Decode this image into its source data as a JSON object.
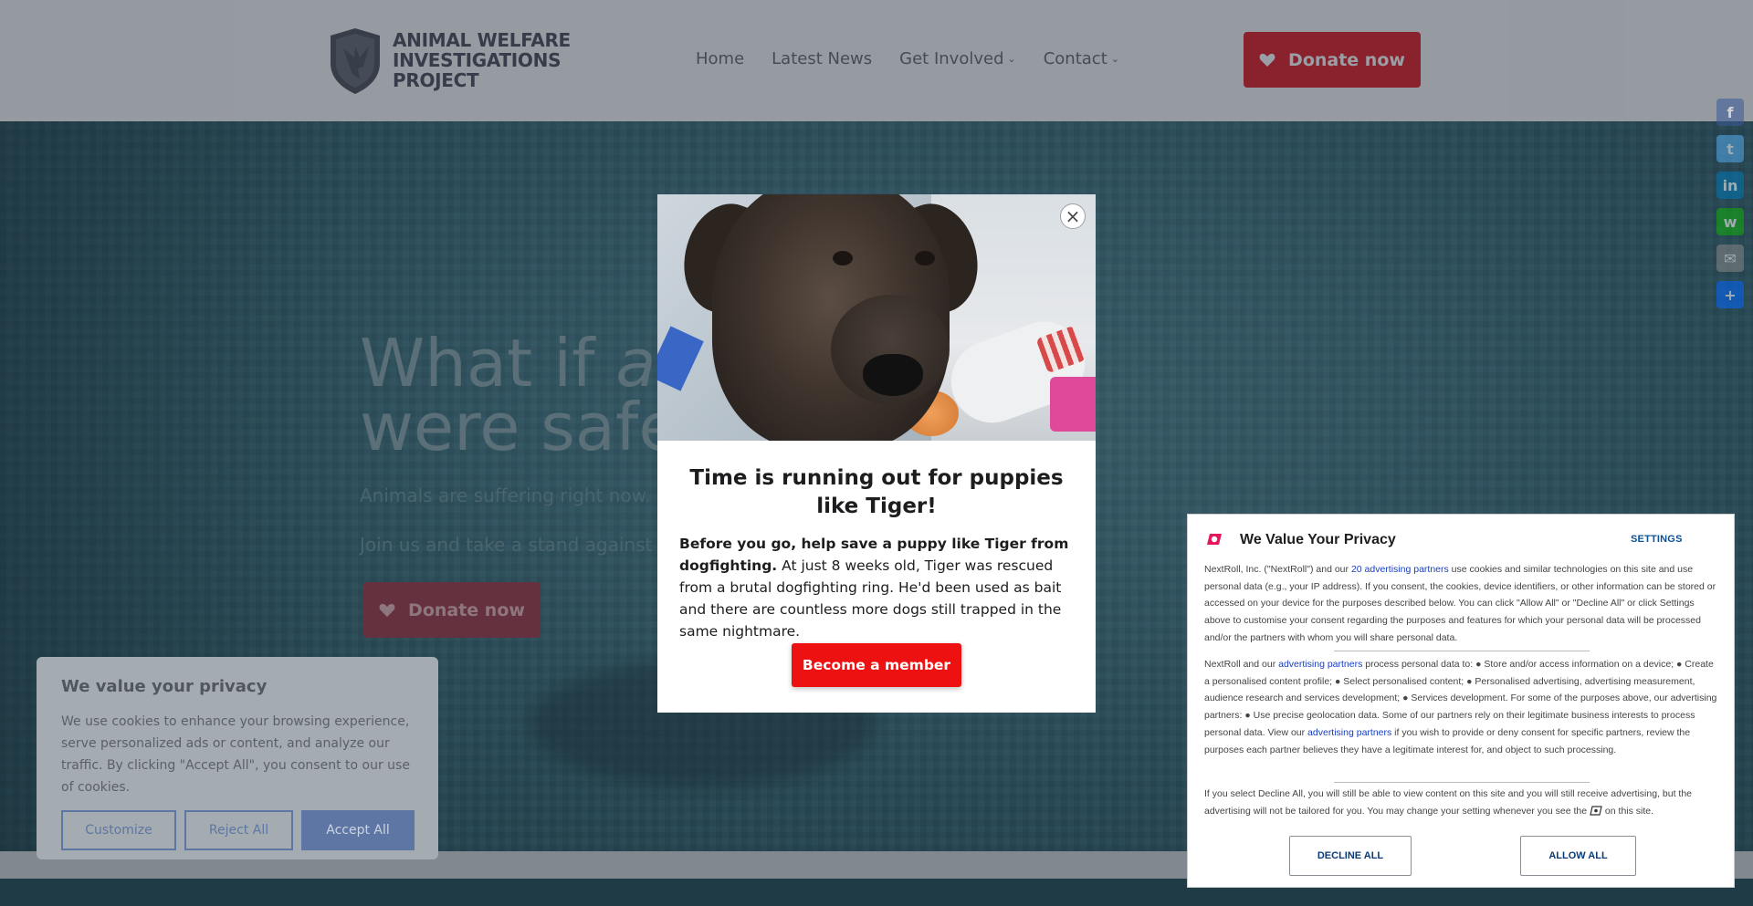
{
  "header": {
    "logo_lines": [
      "ANIMAL WELFARE",
      "INVESTIGATIONS",
      "PROJECT"
    ],
    "nav": [
      {
        "label": "Home",
        "has_dropdown": false
      },
      {
        "label": "Latest News",
        "has_dropdown": false
      },
      {
        "label": "Get Involved",
        "has_dropdown": true
      },
      {
        "label": "Contact",
        "has_dropdown": true
      }
    ],
    "donate_label": "Donate now"
  },
  "hero": {
    "headline_part1": "What if ",
    "headline_italic": "all",
    "headline_line2": "were safe",
    "sub1": "Animals are suffering right now.",
    "sub2": "Join us and take a stand against cr",
    "donate_label": "Donate now"
  },
  "share": {
    "buttons": [
      {
        "name": "facebook-icon",
        "glyph": "f",
        "color": "#3b5998"
      },
      {
        "name": "twitter-icon",
        "glyph": "t",
        "color": "#55acee"
      },
      {
        "name": "linkedin-icon",
        "glyph": "in",
        "color": "#0077b5"
      },
      {
        "name": "whatsapp-icon",
        "glyph": "w",
        "color": "#12af0a"
      },
      {
        "name": "email-icon",
        "glyph": "✉",
        "color": "#888888"
      },
      {
        "name": "share-plus-icon",
        "glyph": "+",
        "color": "#0166ff"
      }
    ]
  },
  "cookie_card": {
    "title": "We value your privacy",
    "body": "We use cookies to enhance your browsing experience, serve personalized ads or content, and analyze our traffic. By clicking \"Accept All\", you consent to our use of cookies.",
    "customize": "Customize",
    "reject": "Reject All",
    "accept": "Accept All"
  },
  "modal": {
    "close_glyph": "×",
    "title": "Time is running out for puppies like Tiger!",
    "body_bold": "Before you go, help save a puppy like Tiger from dogfighting.",
    "body_rest": " At just 8 weeks old, Tiger was rescued from a brutal dogfighting ring. He'd been used as bait and there are countless more dogs still trapped in the same nightmare.",
    "cta": "Become a member"
  },
  "nextroll": {
    "title": "We Value Your Privacy",
    "settings": "SETTINGS",
    "p1_a": "NextRoll, Inc. (\"NextRoll\") and our ",
    "p1_link": "20 advertising partners",
    "p1_b": " use cookies and similar technologies on this site and use personal data (e.g., your IP address). If you consent, the cookies, device identifiers, or other information can be stored or accessed on your device for the purposes described below. You can click \"Allow All\" or \"Decline All\" or click Settings above to customise your consent regarding the purposes and features for which your personal data will be processed and/or the partners with whom you will share personal data.",
    "p2_a": "NextRoll and our ",
    "p2_link1": "advertising partners",
    "p2_b": " process personal data to: ● Store and/or access information on a device; ● Create a personalised content profile; ● Select personalised content; ● Personalised advertising, advertising measurement, audience research and services development; ● Services development. For some of the purposes above, our advertising partners: ● Use precise geolocation data. Some of our partners rely on their legitimate business interests to process personal data. View our ",
    "p2_link2": "advertising partners",
    "p2_c": " if you wish to provide or deny consent for specific partners, review the purposes each partner believes they have a legitimate interest for, and object to such processing.",
    "p3_a": "If you select Decline All, you will still be able to view content on this site and you will still receive advertising, but the advertising will not be tailored for you. You may change your setting whenever you see the ",
    "p3_b": " on this site.",
    "decline": "DECLINE ALL",
    "allow": "ALLOW ALL",
    "brand_color": "#e5165e"
  }
}
